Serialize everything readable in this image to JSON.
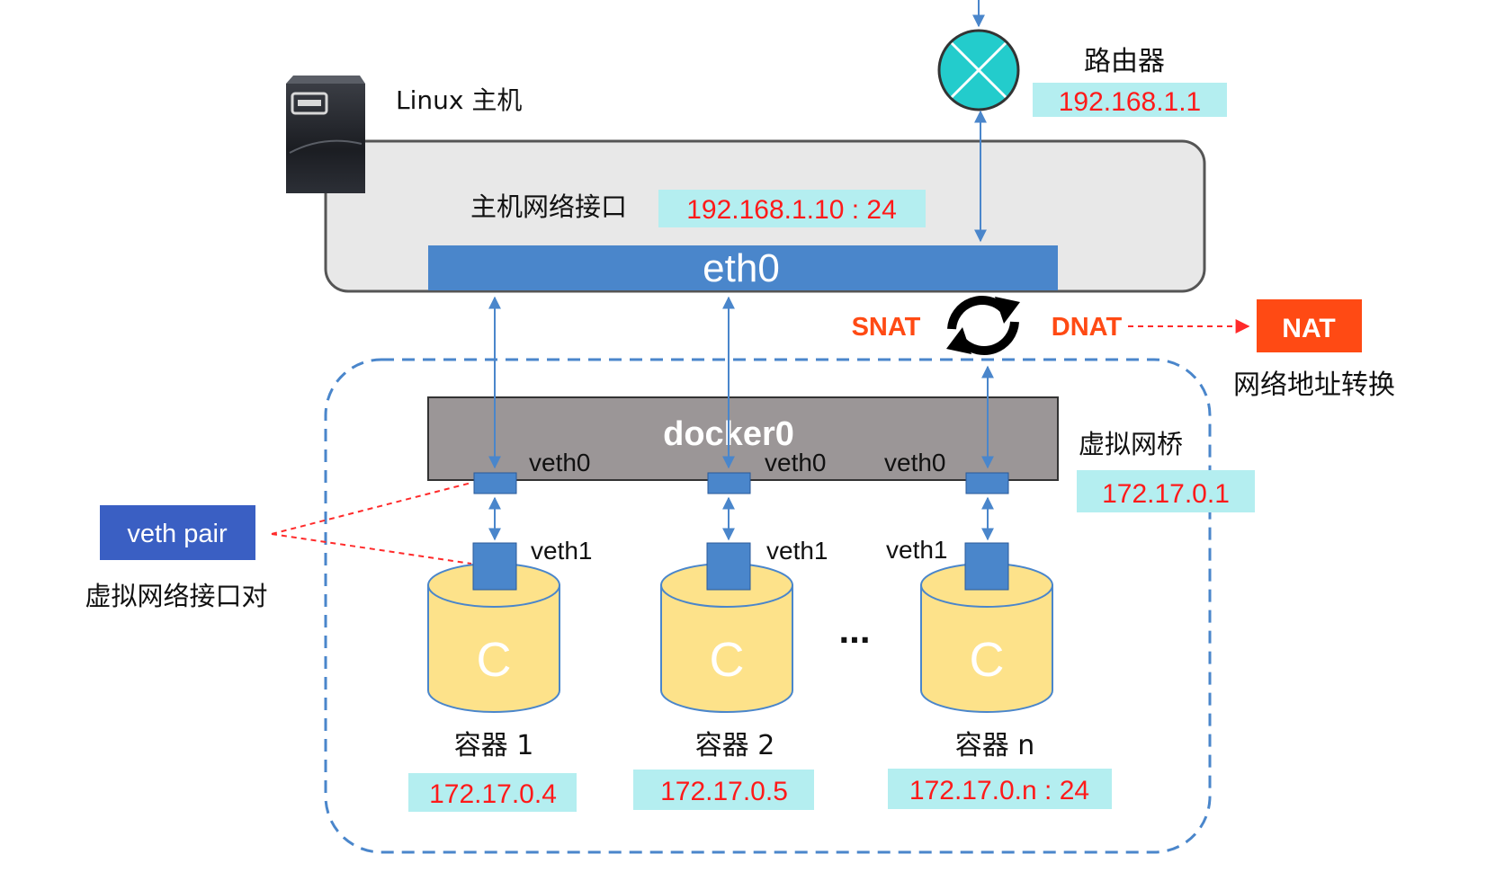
{
  "host": {
    "label": "Linux 主机",
    "iface_label": "主机网络接口",
    "iface_ip": "192.168.1.10 : 24",
    "eth": "eth0"
  },
  "router": {
    "label": "路由器",
    "ip": "192.168.1.1"
  },
  "nat": {
    "snat": "SNAT",
    "dnat": "DNAT",
    "box": "NAT",
    "caption": "网络地址转换"
  },
  "bridge": {
    "name": "docker0",
    "label": "虚拟网桥",
    "ip": "172.17.0.1"
  },
  "veth": {
    "pair_label": "veth pair",
    "pair_caption": "虚拟网络接口对",
    "host_side": [
      "veth0",
      "veth0",
      "veth0"
    ],
    "container_side": [
      "veth1",
      "veth1",
      "veth1"
    ]
  },
  "containers": [
    {
      "glyph": "C",
      "name": "容器 1",
      "ip": "172.17.0.4"
    },
    {
      "glyph": "C",
      "name": "容器 2",
      "ip": "172.17.0.5"
    },
    {
      "glyph": "C",
      "name": "容器 n",
      "ip": "172.17.0.n : 24"
    }
  ],
  "ellipsis": "...",
  "colors": {
    "eth_blue": "#4a86cb",
    "ip_bg": "#b4eef0",
    "ip_text": "#ff1a1a",
    "bridge_gray": "#9b9697",
    "container_yellow": "#fde28a",
    "nat_orange": "#ff4a14",
    "veth_pair_blue": "#3a5fc3",
    "router_teal": "#23cccc"
  }
}
